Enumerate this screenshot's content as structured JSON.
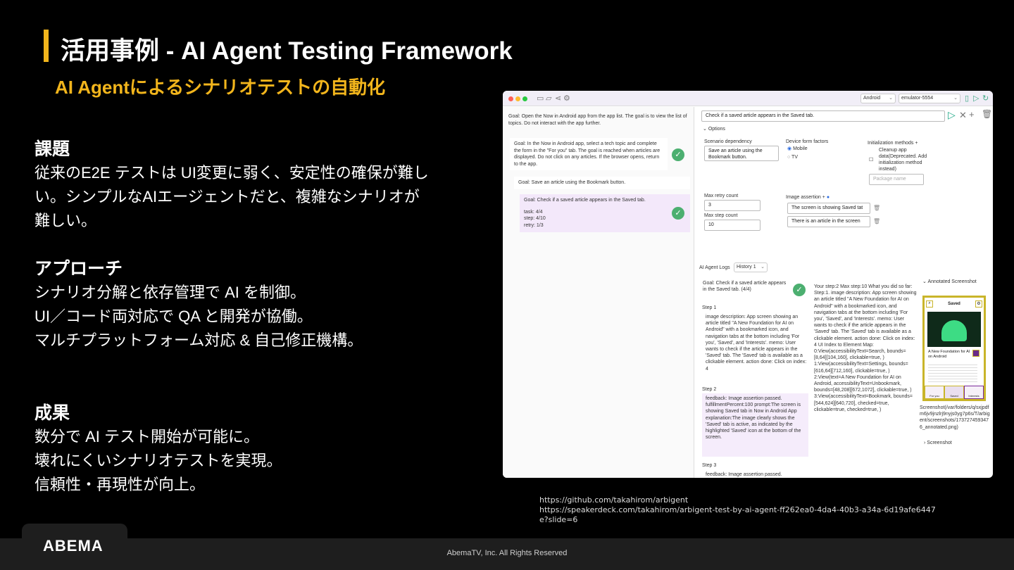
{
  "slide": {
    "title": "活用事例 - AI Agent Testing Framework",
    "subtitle": "AI Agentによるシナリオテストの自動化"
  },
  "sections": [
    {
      "heading": "課題",
      "lines": [
        "従来のE2E テストは UI変更に弱く、安定性の確保が難し",
        "い。シンプルなAIエージェントだと、複雑なシナリオが",
        "難しい。"
      ]
    },
    {
      "heading": "アプローチ",
      "lines": [
        "シナリオ分解と依存管理で AI を制御。",
        "UI／コード両対応で QA と開発が協働。",
        "マルチプラットフォーム対応 & 自己修正機構。"
      ]
    },
    {
      "heading": "成果",
      "lines": [
        "数分で AI テスト開始が可能に。",
        "壊れにくいシナリオテストを実現。",
        "信頼性・再現性が向上。"
      ]
    }
  ],
  "screenshot": {
    "platform_select": "Android",
    "device_select": "emulator-5554",
    "scenarios": [
      "Goal: Open the Now in Android app from the app list. The goal is to view the list of topics. Do not interact with the app further.",
      "Goal: In the Now in Android app, select a tech topic and complete the form in the \"For you\" tab. The goal is reached when articles are displayed. Do not click on any articles. If the browser opens, return to the app.",
      "Goal: Save an article using the Bookmark button.",
      "Goal: Check if a saved article appears in the Saved tab."
    ],
    "scenario_status": [
      "task: 4/4",
      "step: 4/10",
      "retry: 1/3"
    ],
    "goal_input": "Check if a saved article appears in the Saved tab.",
    "options_label": "Options",
    "scenario_dependency_label": "Scenario dependency",
    "scenario_dependency_value": "Save an article using the Bookmark button.",
    "device_form_factors_label": "Device form factors",
    "form_factor_mobile": "Mobile",
    "form_factor_tv": "TV",
    "init_methods_label": "Initialization methods",
    "init_cleanup": "Cleanup app data(Deprecated. Add initialization method instead)",
    "package_placeholder": "Package name",
    "max_retry_label": "Max retry count",
    "max_retry_value": "3",
    "max_step_label": "Max step count",
    "max_step_value": "10",
    "image_assertion_label": "Image assertion",
    "image_assertions": [
      "The screen is showing Saved tat",
      "There is an article in the screen"
    ],
    "logs_label": "AI Agent Logs",
    "history_select": "History 1",
    "log_goal": "Goal: Check if a saved article appears in the Saved tab. (4/4)",
    "step1_label": "Step 1",
    "step1_text": "image description: App screen showing an article titled \"A New Foundation for AI on Android\" with a bookmarked icon, and navigation tabs at the bottom including 'For you', 'Saved', and 'Interests'. memo: User wants to check if the article appears in the 'Saved' tab. The 'Saved' tab is available as a clickable element. action done: Click on index: 4",
    "step2_label": "Step 2",
    "step2_text": "feedback: Image assertion passed. fulfillmentPercent:100 prompt:The screen is showing Saved tab in Now in Android App explanation:The image clearly shows the 'Saved' tab is active, as indicated by the highlighted 'Saved' icon at the bottom of the screen.",
    "step3_label": "Step 3",
    "step3_text": "feedback: Image assertion passed.",
    "detail_text": "Your step:2 Max step:10 What you did so far: Step:1. image description: App screen showing an article titled \"A New Foundation for AI on Android\" with a bookmarked icon, and navigation tabs at the bottom including 'For you', 'Saved', and 'Interests'. memo: User wants to check if the article appears in the 'Saved' tab. The 'Saved' tab is available as a clickable element. action done: Click on index: 4 UI Index to Element Map: 0:View(accessibilityText=Search, bounds=[8,64][104,160], clickable=true, ) 1:View(accessibilityText=Settings, bounds=[616,64][712,160], clickable=true, ) 2:View(text=A New Foundation for AI on Android, accessibilityText=Unbookmark, bounds=[48,208][672,1072], clickable=true, ) 3:View(accessibilityText=Bookmark, bounds=[544,624][640,720], checked=true, clickable=true, checked=true, )",
    "annotated_label": "Annotated Screenshot",
    "phone_title": "Saved",
    "phone_article": "A New Foundation for AI on Android",
    "phone_tabs": [
      "For you",
      "Saved",
      "Interests"
    ],
    "screenshot_path": "Screenshot(/var/folders/q/sxjpdfm6jv9jnzlrj9nyjs0yg7p6s/T/arbigent/screenshots/1737274593476_annotated.png)",
    "screenshot_label": "Screenshot"
  },
  "links": [
    "https://github.com/takahirom/arbigent",
    "https://speakerdeck.com/takahirom/arbigent-test-by-ai-agent-ff262ea0-4da4-40b3-a34a-6d19afe6447",
    "e?slide=6"
  ],
  "footer": {
    "logo": "ABEMA",
    "copyright": "AbemaTV, Inc. All Rights Reserved"
  },
  "colors": {
    "accent": "#f2b51c",
    "background": "#000000",
    "footer": "#1e1e1e"
  }
}
